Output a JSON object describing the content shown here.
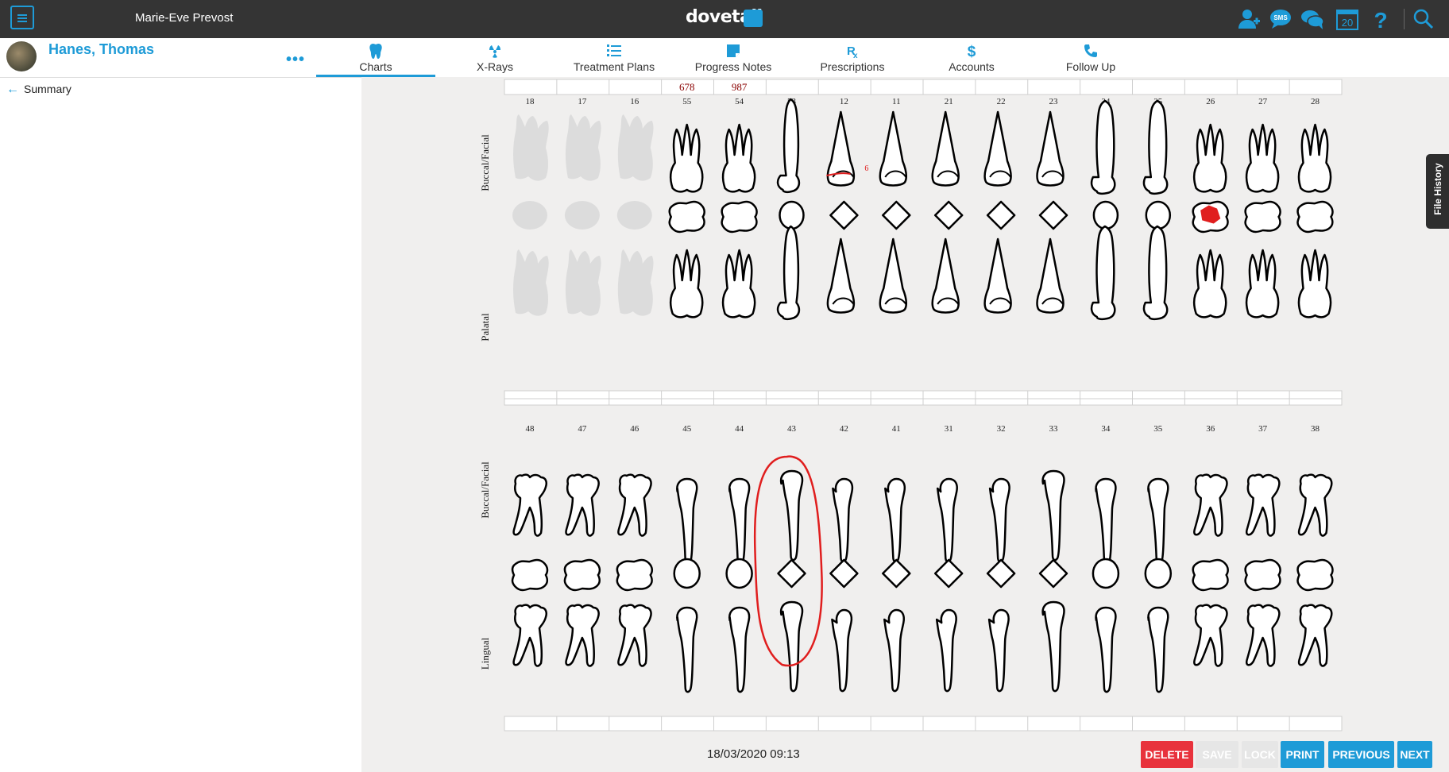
{
  "topbar": {
    "user_name": "Marie-Eve Prevost",
    "logo": "dovetail",
    "icons": [
      "add-patient-icon",
      "sms-icon",
      "chat-icon",
      "calendar-icon",
      "help-icon",
      "search-icon"
    ],
    "calendar_day": "20",
    "accent_color": "#1e9bd7"
  },
  "patient": {
    "name": "Hanes, Thomas"
  },
  "tabs": [
    {
      "label": "Charts",
      "icon": "tooth-icon",
      "active": true
    },
    {
      "label": "X-Rays",
      "icon": "radiation-icon"
    },
    {
      "label": "Treatment Plans",
      "icon": "list-icon"
    },
    {
      "label": "Progress Notes",
      "icon": "note-icon"
    },
    {
      "label": "Prescriptions",
      "icon": "rx-icon"
    },
    {
      "label": "Accounts",
      "icon": "dollar-icon"
    },
    {
      "label": "Follow Up",
      "icon": "phone-icon"
    }
  ],
  "sidebar": {
    "back_label": "Summary"
  },
  "chart": {
    "upper_teeth": [
      "18",
      "17",
      "16",
      "55",
      "54",
      "53",
      "12",
      "11",
      "21",
      "22",
      "23",
      "24",
      "25",
      "26",
      "27",
      "28"
    ],
    "lower_teeth": [
      "48",
      "47",
      "46",
      "45",
      "44",
      "43",
      "42",
      "41",
      "31",
      "32",
      "33",
      "34",
      "35",
      "36",
      "37",
      "38"
    ],
    "upper_labels": [
      "Buccal/Facial",
      "Palatal"
    ],
    "lower_labels": [
      "Buccal/Facial",
      "Lingual"
    ],
    "annotations": [
      {
        "tooth": "55",
        "text": "678"
      },
      {
        "tooth": "54",
        "text": "987"
      },
      {
        "tooth": "12",
        "text": "6"
      }
    ],
    "missing_teeth": [
      "18",
      "17",
      "16"
    ],
    "restored_teeth": [
      "26"
    ],
    "circled_tooth": "43",
    "mark_color": "#e01e1e"
  },
  "footer": {
    "timestamp": "18/03/2020 09:13",
    "buttons": [
      {
        "label": "DELETE",
        "color": "#e8323c",
        "enabled": true
      },
      {
        "label": "SAVE",
        "color": "#e6e6e6",
        "enabled": false
      },
      {
        "label": "LOCK",
        "color": "#e6e6e6",
        "enabled": false
      },
      {
        "label": "PRINT",
        "color": "#1e9bd7",
        "enabled": true
      },
      {
        "label": "PREVIOUS",
        "color": "#1e9bd7",
        "enabled": true
      },
      {
        "label": "NEXT",
        "color": "#1e9bd7",
        "enabled": true
      }
    ]
  },
  "file_history": {
    "label": "File History"
  }
}
